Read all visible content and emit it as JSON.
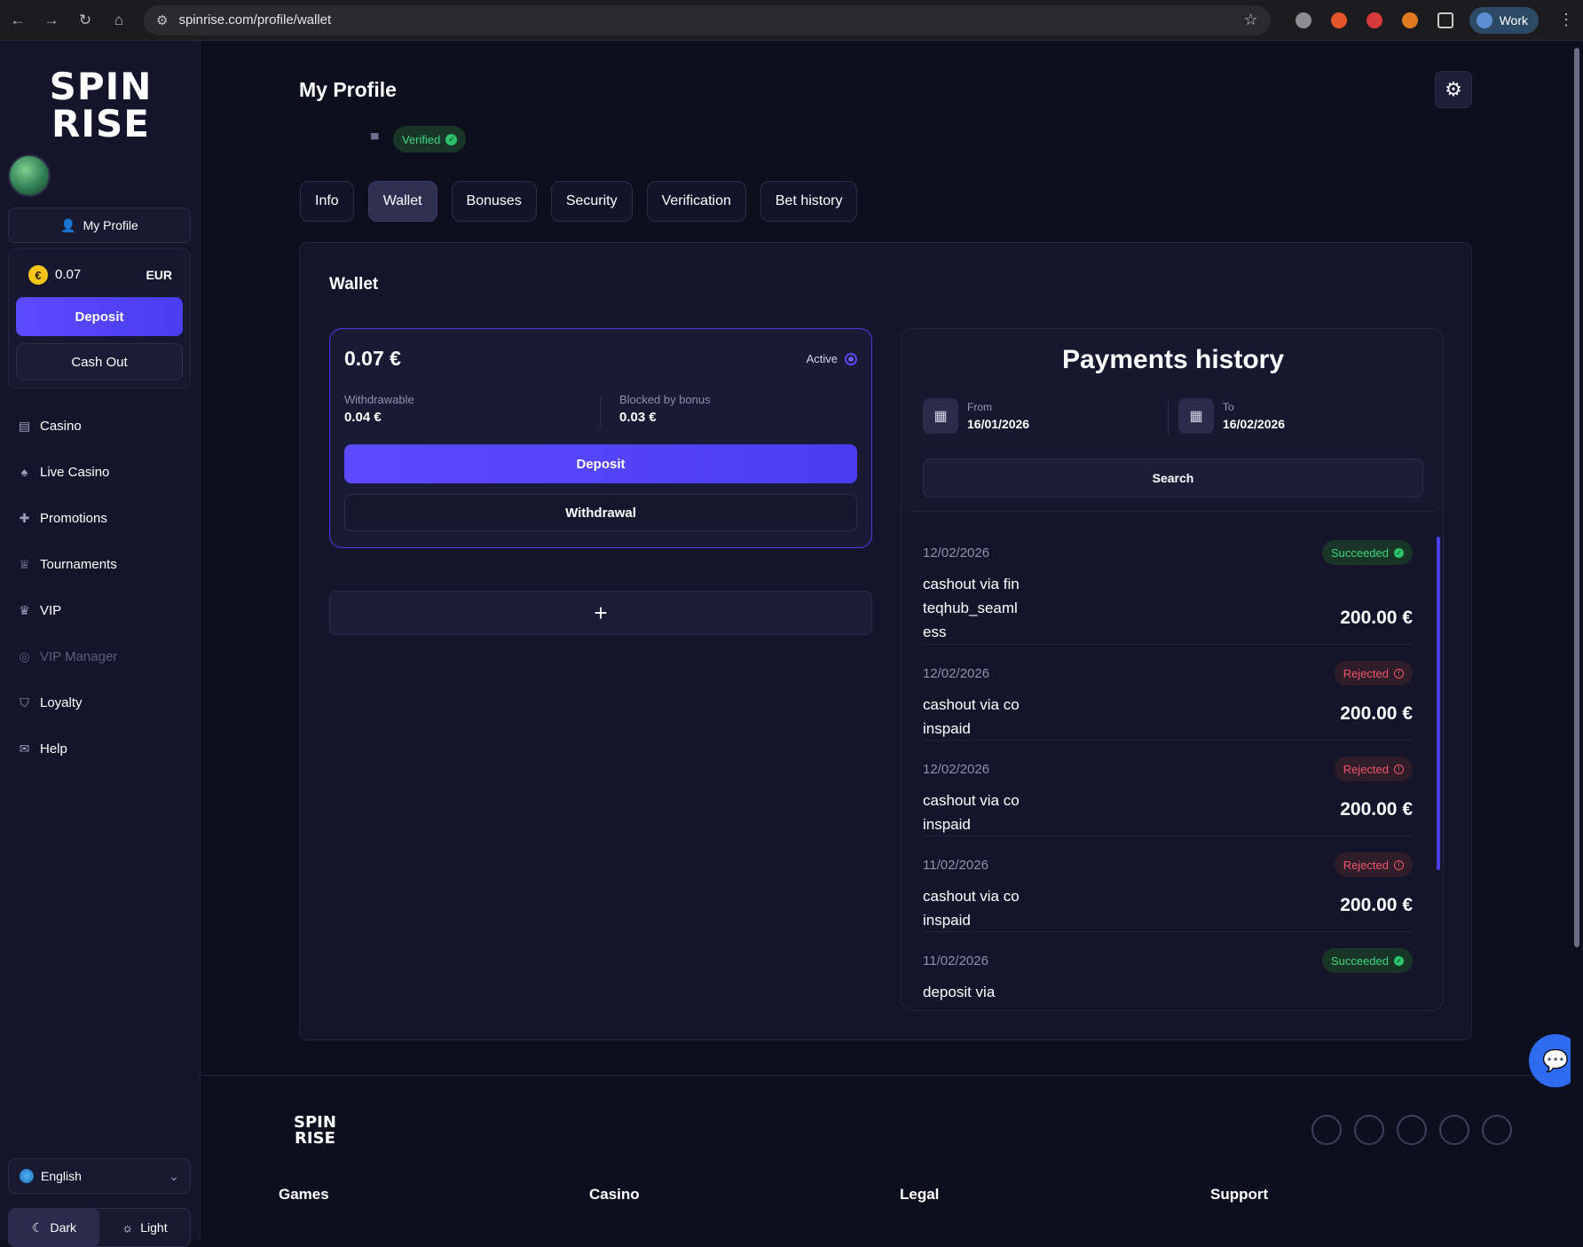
{
  "browser": {
    "url": "spinrise.com/profile/wallet",
    "profile_label": "Work"
  },
  "sidebar": {
    "logo_top": "SPIN",
    "logo_bottom": "RISE",
    "profile_button": "My Profile",
    "balance": {
      "amount": "0.07",
      "currency": "EUR",
      "coin_symbol": "€"
    },
    "deposit_label": "Deposit",
    "cashout_label": "Cash Out",
    "menu": [
      {
        "label": "Casino",
        "icon": "casino-icon"
      },
      {
        "label": "Live Casino",
        "icon": "live-casino-icon"
      },
      {
        "label": "Promotions",
        "icon": "gift-icon"
      },
      {
        "label": "Tournaments",
        "icon": "trophy-icon"
      },
      {
        "label": "VIP",
        "icon": "crown-icon"
      },
      {
        "label": "VIP Manager",
        "icon": "headset-icon"
      },
      {
        "label": "Loyalty",
        "icon": "shield-icon"
      },
      {
        "label": "Help",
        "icon": "mail-icon"
      }
    ],
    "language": "English",
    "theme": {
      "dark": "Dark",
      "light": "Light",
      "selected": "dark"
    }
  },
  "profile": {
    "title": "My Profile",
    "verified_label": "Verified",
    "tabs": [
      "Info",
      "Wallet",
      "Bonuses",
      "Security",
      "Verification",
      "Bet history"
    ],
    "active_tab": "Wallet"
  },
  "wallet": {
    "title": "Wallet",
    "amount": "0.07 €",
    "status": "Active",
    "withdrawable_label": "Withdrawable",
    "withdrawable_value": "0.04 €",
    "blocked_label": "Blocked by bonus",
    "blocked_value": "0.03 €",
    "deposit_label": "Deposit",
    "withdrawal_label": "Withdrawal",
    "add_label": "+"
  },
  "payments": {
    "title": "Payments history",
    "from_label": "From",
    "from_value": "16/01/2026",
    "to_label": "To",
    "to_value": "16/02/2026",
    "search_label": "Search",
    "items": [
      {
        "date": "12/02/2026",
        "desc": "cashout via finteqhub_seamless",
        "status": "Succeeded",
        "amount": "200.00 €"
      },
      {
        "date": "12/02/2026",
        "desc": "cashout via coinspaid",
        "status": "Rejected",
        "amount": "200.00 €"
      },
      {
        "date": "12/02/2026",
        "desc": "cashout via coinspaid",
        "status": "Rejected",
        "amount": "200.00 €"
      },
      {
        "date": "11/02/2026",
        "desc": "cashout via coinspaid",
        "status": "Rejected",
        "amount": "200.00 €"
      },
      {
        "date": "11/02/2026",
        "desc": "deposit via",
        "status": "Succeeded",
        "amount": ""
      }
    ]
  },
  "footer": {
    "logo_top": "SPIN",
    "logo_bottom": "RISE",
    "columns": [
      "Games",
      "Casino",
      "Legal",
      "Support"
    ]
  },
  "colors": {
    "accent": "#5b4bff",
    "success": "#3ed57c",
    "danger": "#f0566a",
    "bg": "#0e0f1e"
  }
}
